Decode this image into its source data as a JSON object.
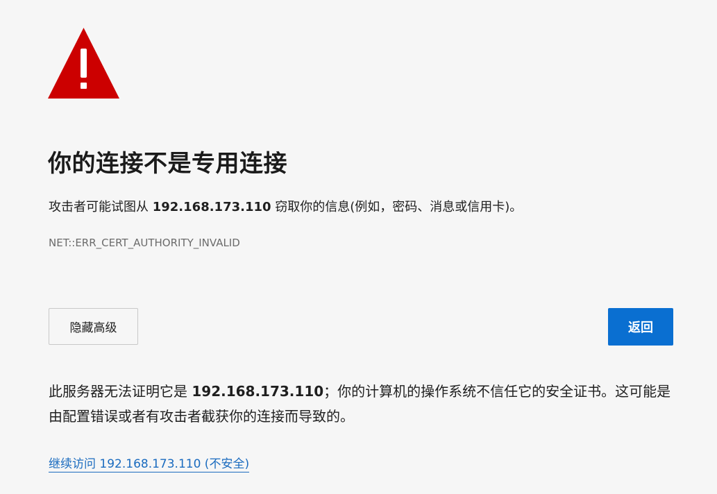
{
  "icon": {
    "name": "warning-triangle-icon",
    "color": "#cc0000"
  },
  "title": "你的连接不是专用连接",
  "description": {
    "before": "攻击者可能试图从 ",
    "host": "192.168.173.110",
    "after": " 窃取你的信息(例如，密码、消息或信用卡)。"
  },
  "error_code": "NET::ERR_CERT_AUTHORITY_INVALID",
  "buttons": {
    "advanced_label": "隐藏高级",
    "back_label": "返回",
    "back_color": "#0a6fd1"
  },
  "details": {
    "before": "此服务器无法证明它是 ",
    "host": "192.168.173.110",
    "after": "；你的计算机的操作系统不信任它的安全证书。这可能是由配置错误或者有攻击者截获你的连接而导致的。"
  },
  "proceed_link": "继续访问 192.168.173.110 (不安全)"
}
